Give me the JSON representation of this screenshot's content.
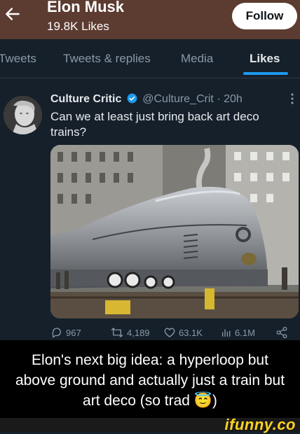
{
  "profile": {
    "name": "Elon Musk",
    "likes": "19.8K Likes",
    "follow_label": "Follow"
  },
  "tabs": [
    {
      "label": "Tweets",
      "active": false
    },
    {
      "label": "Tweets & replies",
      "active": false
    },
    {
      "label": "Media",
      "active": false
    },
    {
      "label": "Likes",
      "active": true
    }
  ],
  "tweet": {
    "author_name": "Culture Critic",
    "handle": "@Culture_Crit",
    "separator": "·",
    "time": "20h",
    "text": "Can we at least just bring back art deco trains?",
    "actions": {
      "replies": "967",
      "retweets": "4,189",
      "likes": "63.1K",
      "views": "6.1M"
    }
  },
  "caption": "Elon's next big idea: a hyperloop but above ground and actually just a train but art deco (so trad 😇)",
  "watermark": "ifunny.co",
  "colors": {
    "header_bg": "#5c3b30",
    "page_bg": "#15202b",
    "accent": "#1d9bf0",
    "muted": "#8b98a5",
    "verified": "#1d9bf0"
  },
  "icons": [
    "back-arrow-icon",
    "verified-badge-icon",
    "more-icon",
    "reply-icon",
    "retweet-icon",
    "like-icon",
    "views-icon",
    "share-icon"
  ]
}
